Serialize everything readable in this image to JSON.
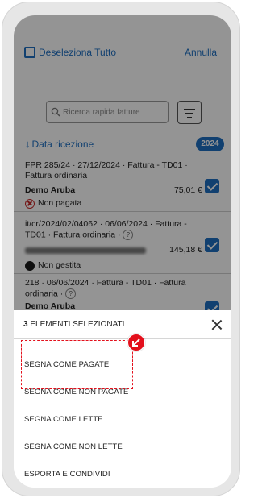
{
  "header": {
    "deselect_label": "Deseleziona Tutto",
    "cancel_label": "Annulla"
  },
  "search": {
    "placeholder": "Ricerca rapida fatture"
  },
  "sort": {
    "arrow": "↓",
    "label": "Data ricezione",
    "year_badge": "2024"
  },
  "invoices": [
    {
      "line1": "FPR 285/24 · 27/12/2024 · Fattura - TD01 ·",
      "line2": "Fattura ordinaria",
      "sender": "Demo Aruba",
      "amount": "75,01 €",
      "status": "Non pagata",
      "status_icon": "x-circle-icon",
      "selected": true
    },
    {
      "line1": "it/cr/2024/02/04062 · 06/06/2024 · Fattura -",
      "line2": "TD01 · Fattura ordinaria ·",
      "sender": "",
      "amount": "145,18 €",
      "status": "Non gestita",
      "status_icon": "black-dot-icon",
      "selected": true
    },
    {
      "line1": "218 · 06/06/2024 · Fattura - TD01 · Fattura",
      "line2": "ordinaria ·",
      "sender": "Demo Aruba",
      "amount": "",
      "status": "",
      "selected": true
    }
  ],
  "sheet": {
    "count": "3",
    "title": "ELEMENTI SELEZIONATI",
    "actions": [
      "SEGNA COME PAGATE",
      "SEGNA COME NON PAGATE",
      "SEGNA COME LETTE",
      "SEGNA COME NON LETTE",
      "ESPORTA E CONDIVIDI"
    ]
  },
  "colors": {
    "accent": "#1e6fc2",
    "highlight": "#e3101c",
    "overlay": "rgba(0,0,0,0.42)"
  }
}
